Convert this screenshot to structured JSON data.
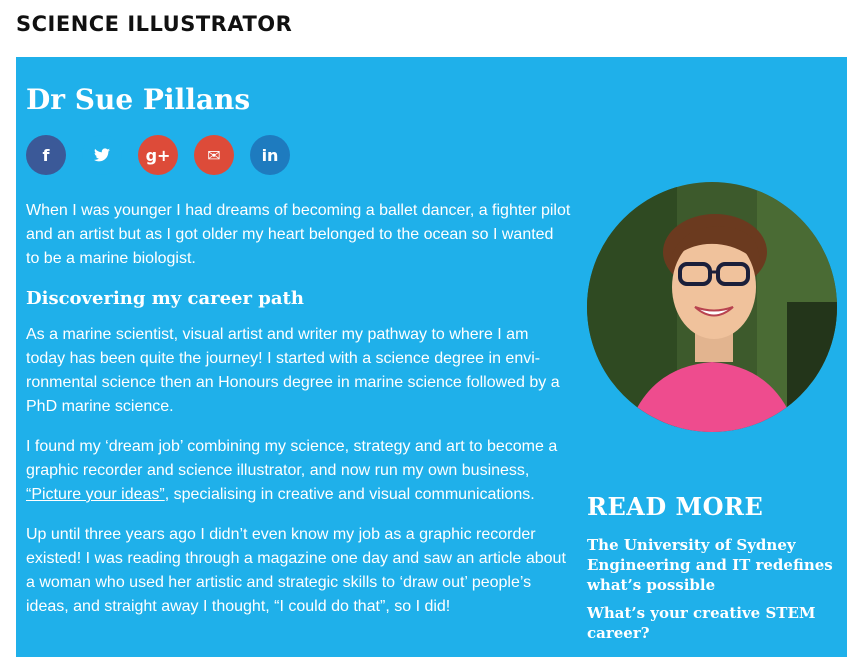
{
  "header": {
    "title": "SCIENCE ILLUSTRATOR"
  },
  "profile": {
    "name": "Dr Sue Pillans"
  },
  "social": [
    {
      "icon": "facebook-icon",
      "glyph": "f",
      "color": "#3b5998"
    },
    {
      "icon": "twitter-icon",
      "glyph": "🐦",
      "color": "#1fb0ea"
    },
    {
      "icon": "google-plus-icon",
      "glyph": "g+",
      "color": "#dd4b39"
    },
    {
      "icon": "email-icon",
      "glyph": "✉",
      "color": "#dd4b39"
    },
    {
      "icon": "linkedin-icon",
      "glyph": "in",
      "color": "#1e7bbf"
    }
  ],
  "article": {
    "intro": "When I was younger I had dreams of becoming a ballet dancer, a fighter pilot and an artist but as I got older my heart belonged to the ocean so I wanted to be a marine biologist.",
    "section_heading": "Discovering my career path",
    "p2": "As a marine scientist, visual artist and writer my pathway to where I am today has been quite the journey! I started with a science degree in envi-ronmental science then an Honours degree in marine science followed by a PhD marine science.",
    "p3_before": "I found my ‘dream job’ combining my science, strategy and art to become a graphic recorder and science illustrator, and now run my own business, ",
    "p3_link": "“Picture your ideas”",
    "p3_after": ", specialising in creative and visual communications.",
    "p4": "Up until three years ago I didn’t even know my job as a graphic recorder existed! I was reading through a magazine one day and saw an article about a woman who used her artistic and strategic skills to ‘draw out’ people’s ideas, and straight away I thought, “I could do that”, so I did!"
  },
  "sidebar": {
    "heading": "READ MORE",
    "links": [
      "The University of Sydney Engineering and IT redefines what’s possible",
      "What’s your creative STEM career?"
    ]
  },
  "colors": {
    "panel": "#1fb0ea",
    "shirt": "#ee4c8e",
    "foliage": "#3d5a2c"
  }
}
